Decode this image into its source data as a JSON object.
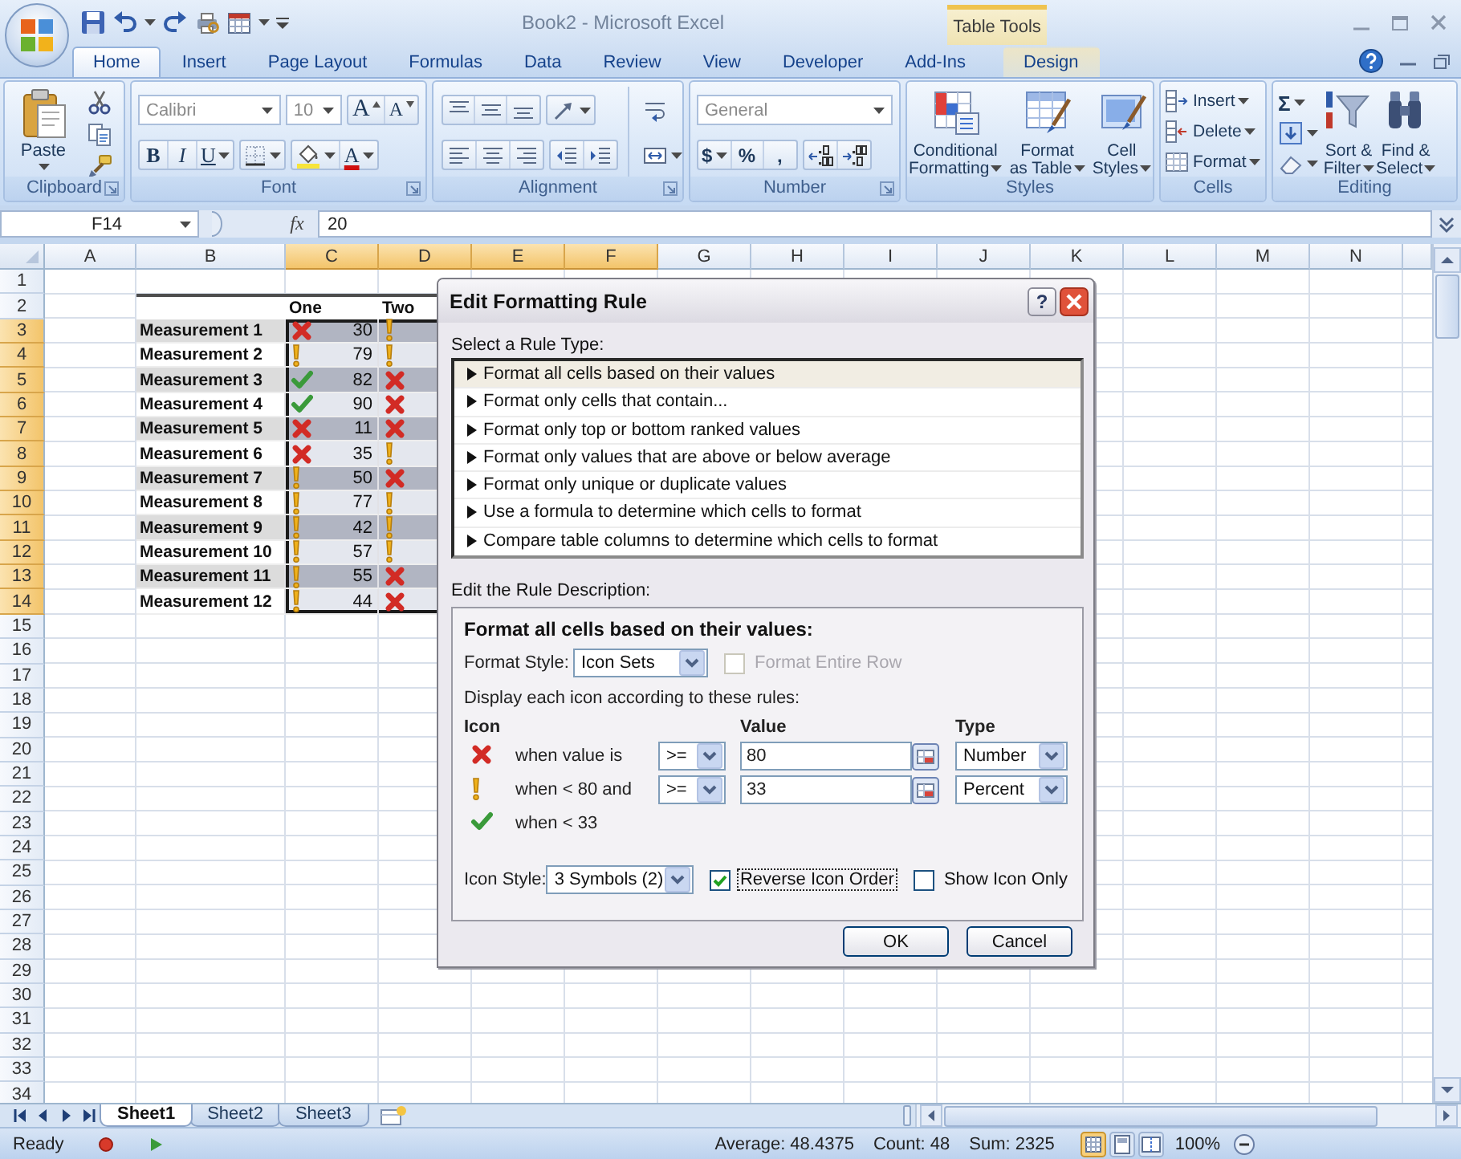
{
  "window": {
    "title": "Book2 - Microsoft Excel",
    "context_group": "Table Tools"
  },
  "ribbon_tabs": [
    {
      "label": "Home",
      "selected": true,
      "contextual": false
    },
    {
      "label": "Insert",
      "selected": false,
      "contextual": false
    },
    {
      "label": "Page Layout",
      "selected": false,
      "contextual": false
    },
    {
      "label": "Formulas",
      "selected": false,
      "contextual": false
    },
    {
      "label": "Data",
      "selected": false,
      "contextual": false
    },
    {
      "label": "Review",
      "selected": false,
      "contextual": false
    },
    {
      "label": "View",
      "selected": false,
      "contextual": false
    },
    {
      "label": "Developer",
      "selected": false,
      "contextual": false
    },
    {
      "label": "Add-Ins",
      "selected": false,
      "contextual": false
    },
    {
      "label": "Design",
      "selected": false,
      "contextual": true
    }
  ],
  "ribbon": {
    "clipboard": {
      "label": "Clipboard",
      "paste": "Paste"
    },
    "font": {
      "label": "Font",
      "font_name": "Calibri",
      "font_size": "10",
      "grow": "A",
      "shrink": "A",
      "bold": "B",
      "italic": "I",
      "underline": "U",
      "font_color": "A"
    },
    "alignment": {
      "label": "Alignment"
    },
    "number": {
      "label": "Number",
      "format": "General",
      "currency": "$",
      "percent": "%",
      "comma": ","
    },
    "styles": {
      "label": "Styles",
      "buttons": [
        {
          "kind": "conditional",
          "lines": [
            "Conditional",
            "Formatting"
          ]
        },
        {
          "kind": "table",
          "lines": [
            "Format",
            "as Table"
          ]
        },
        {
          "kind": "cell",
          "lines": [
            "Cell",
            "Styles"
          ]
        }
      ]
    },
    "cells": {
      "label": "Cells",
      "buttons": [
        {
          "kind": "insert",
          "label": "Insert"
        },
        {
          "kind": "delete",
          "label": "Delete"
        },
        {
          "kind": "format",
          "label": "Format"
        }
      ]
    },
    "editing": {
      "label": "Editing",
      "autosum": "Σ",
      "buttons": [
        {
          "kind": "sort",
          "lines": [
            "Sort &",
            "Filter"
          ]
        },
        {
          "kind": "find",
          "lines": [
            "Find &",
            "Select"
          ]
        }
      ]
    }
  },
  "formula_bar": {
    "name_box": "F14",
    "function_button": "fx",
    "formula": "20"
  },
  "sheet": {
    "columns": [
      {
        "label": "A",
        "selected": false
      },
      {
        "label": "B",
        "selected": false
      },
      {
        "label": "C",
        "selected": true
      },
      {
        "label": "D",
        "selected": true
      },
      {
        "label": "E",
        "selected": true
      },
      {
        "label": "F",
        "selected": true
      },
      {
        "label": "G",
        "selected": false
      },
      {
        "label": "H",
        "selected": false
      },
      {
        "label": "I",
        "selected": false
      },
      {
        "label": "J",
        "selected": false
      },
      {
        "label": "K",
        "selected": false
      },
      {
        "label": "L",
        "selected": false
      },
      {
        "label": "M",
        "selected": false
      },
      {
        "label": "N",
        "selected": false
      }
    ],
    "rows": [
      {
        "label": "1",
        "selected": false
      },
      {
        "label": "2",
        "selected": false
      },
      {
        "label": "3",
        "selected": true
      },
      {
        "label": "4",
        "selected": true
      },
      {
        "label": "5",
        "selected": true
      },
      {
        "label": "6",
        "selected": true
      },
      {
        "label": "7",
        "selected": true
      },
      {
        "label": "8",
        "selected": true
      },
      {
        "label": "9",
        "selected": true
      },
      {
        "label": "10",
        "selected": true
      },
      {
        "label": "11",
        "selected": true
      },
      {
        "label": "12",
        "selected": true
      },
      {
        "label": "13",
        "selected": true
      },
      {
        "label": "14",
        "selected": true
      },
      {
        "label": "15",
        "selected": false
      },
      {
        "label": "16",
        "selected": false
      },
      {
        "label": "17",
        "selected": false
      },
      {
        "label": "18",
        "selected": false
      },
      {
        "label": "19",
        "selected": false
      },
      {
        "label": "20",
        "selected": false
      },
      {
        "label": "21",
        "selected": false
      },
      {
        "label": "22",
        "selected": false
      },
      {
        "label": "23",
        "selected": false
      },
      {
        "label": "24",
        "selected": false
      },
      {
        "label": "25",
        "selected": false
      },
      {
        "label": "26",
        "selected": false
      },
      {
        "label": "27",
        "selected": false
      },
      {
        "label": "28",
        "selected": false
      },
      {
        "label": "29",
        "selected": false
      },
      {
        "label": "30",
        "selected": false
      },
      {
        "label": "31",
        "selected": false
      },
      {
        "label": "32",
        "selected": false
      },
      {
        "label": "33",
        "selected": false
      },
      {
        "label": "34",
        "selected": false
      }
    ]
  },
  "table": {
    "header": [
      "One",
      "Two"
    ],
    "rows": [
      {
        "name": "Measurement 1",
        "values": [
          {
            "kind": "cross",
            "value": "30"
          },
          {
            "kind": "exclaim"
          }
        ]
      },
      {
        "name": "Measurement 2",
        "values": [
          {
            "kind": "exclaim",
            "value": "79"
          },
          {
            "kind": "exclaim"
          }
        ]
      },
      {
        "name": "Measurement 3",
        "values": [
          {
            "kind": "check",
            "value": "82"
          },
          {
            "kind": "cross"
          }
        ]
      },
      {
        "name": "Measurement 4",
        "values": [
          {
            "kind": "check",
            "value": "90"
          },
          {
            "kind": "cross"
          }
        ]
      },
      {
        "name": "Measurement 5",
        "values": [
          {
            "kind": "cross",
            "value": "11"
          },
          {
            "kind": "cross"
          }
        ]
      },
      {
        "name": "Measurement 6",
        "values": [
          {
            "kind": "cross",
            "value": "35"
          },
          {
            "kind": "exclaim"
          }
        ]
      },
      {
        "name": "Measurement 7",
        "values": [
          {
            "kind": "exclaim",
            "value": "50"
          },
          {
            "kind": "cross"
          }
        ]
      },
      {
        "name": "Measurement 8",
        "values": [
          {
            "kind": "exclaim",
            "value": "77"
          },
          {
            "kind": "exclaim"
          }
        ]
      },
      {
        "name": "Measurement 9",
        "values": [
          {
            "kind": "exclaim",
            "value": "42"
          },
          {
            "kind": "exclaim"
          }
        ]
      },
      {
        "name": "Measurement 10",
        "values": [
          {
            "kind": "exclaim",
            "value": "57"
          },
          {
            "kind": "exclaim"
          }
        ]
      },
      {
        "name": "Measurement 11",
        "values": [
          {
            "kind": "exclaim",
            "value": "55"
          },
          {
            "kind": "cross"
          }
        ]
      },
      {
        "name": "Measurement 12",
        "values": [
          {
            "kind": "exclaim",
            "value": "44"
          },
          {
            "kind": "cross"
          }
        ]
      }
    ]
  },
  "dialog": {
    "title": "Edit Formatting Rule",
    "help_button": "?",
    "rule_type_label": "Select a Rule Type:",
    "rule_types": [
      {
        "label": "Format all cells based on their values",
        "selected": true
      },
      {
        "label": "Format only cells that contain...",
        "selected": false
      },
      {
        "label": "Format only top or bottom ranked values",
        "selected": false
      },
      {
        "label": "Format only values that are above or below average",
        "selected": false
      },
      {
        "label": "Format only unique or duplicate values",
        "selected": false
      },
      {
        "label": "Use a formula to determine which cells to format",
        "selected": false
      },
      {
        "label": "Compare table columns to determine which cells to format",
        "selected": false
      }
    ],
    "description_label": "Edit the Rule Description:",
    "description_heading": "Format all cells based on their values:",
    "format_style": {
      "label": "Format Style:",
      "value": "Icon Sets"
    },
    "format_entire_row": {
      "label": "Format Entire Row",
      "checked": false,
      "disabled": true
    },
    "rules_label": "Display each icon according to these rules:",
    "rule_headers": {
      "icon": "Icon",
      "value": "Value",
      "type": "Type"
    },
    "icon_rules": [
      {
        "kind": "cross",
        "condition": "when value is",
        "operator": ">=",
        "value": "80",
        "type": "Number"
      },
      {
        "kind": "exclaim",
        "condition": "when < 80 and",
        "operator": ">=",
        "value": "33",
        "type": "Percent"
      },
      {
        "kind": "check",
        "condition": "when < 33"
      }
    ],
    "icon_style": {
      "label": "Icon Style:",
      "value": "3 Symbols (2)"
    },
    "options": [
      {
        "label": "Reverse Icon Order",
        "checked": true,
        "focused": true
      },
      {
        "label": "Show Icon Only",
        "checked": false,
        "focused": false
      }
    ],
    "buttons": [
      {
        "label": "OK"
      },
      {
        "label": "Cancel"
      }
    ]
  },
  "sheet_tabs": [
    {
      "label": "Sheet1",
      "selected": true
    },
    {
      "label": "Sheet2",
      "selected": false
    },
    {
      "label": "Sheet3",
      "selected": false
    }
  ],
  "status_bar": {
    "mode": "Ready",
    "average": "Average: 48.4375",
    "count": "Count: 48",
    "sum": "Sum: 2325",
    "views": [
      {
        "kind": "normal",
        "selected": true
      },
      {
        "kind": "layout",
        "selected": false
      },
      {
        "kind": "pagebreak",
        "selected": false
      }
    ],
    "zoom": "100%"
  }
}
